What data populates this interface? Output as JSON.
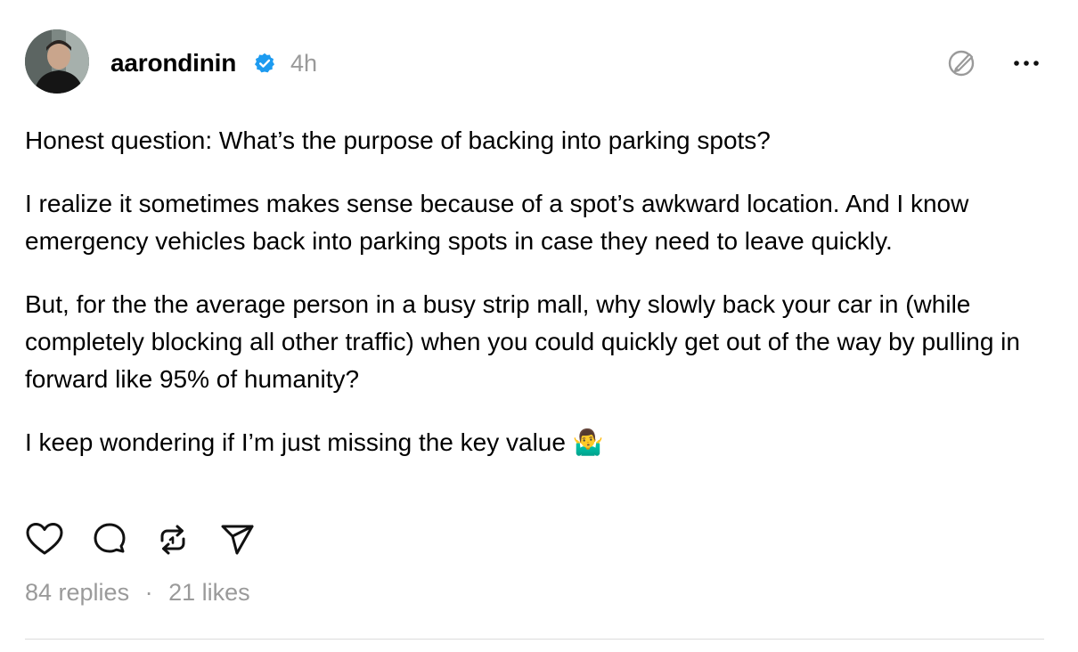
{
  "post": {
    "author": {
      "username": "aarondinin",
      "verified": true,
      "avatar_icon": "avatar-photo"
    },
    "timestamp": "4h",
    "header_icons": [
      "edit-circle-icon",
      "more-icon"
    ],
    "paragraphs": [
      "Honest question: What’s the purpose of backing into parking spots?",
      "I realize it sometimes makes sense because of a spot’s awkward location. And I know emergency vehicles back into parking spots in case they need to leave quickly.",
      "But, for the the average person in a busy strip mall, why slowly back your car in (while completely blocking all other traffic) when you could quickly get out of the way by pulling in forward like 95% of humanity?",
      "I keep wondering if I’m just missing the key value 🤷‍♂️"
    ],
    "actions": [
      "like-icon",
      "reply-icon",
      "repost-icon",
      "share-icon"
    ],
    "stats": {
      "replies": "84 replies",
      "separator": "·",
      "likes": "21 likes"
    },
    "colors": {
      "verified": "#1d9bf0",
      "muted": "#9a9a9a",
      "text": "#000000"
    }
  }
}
